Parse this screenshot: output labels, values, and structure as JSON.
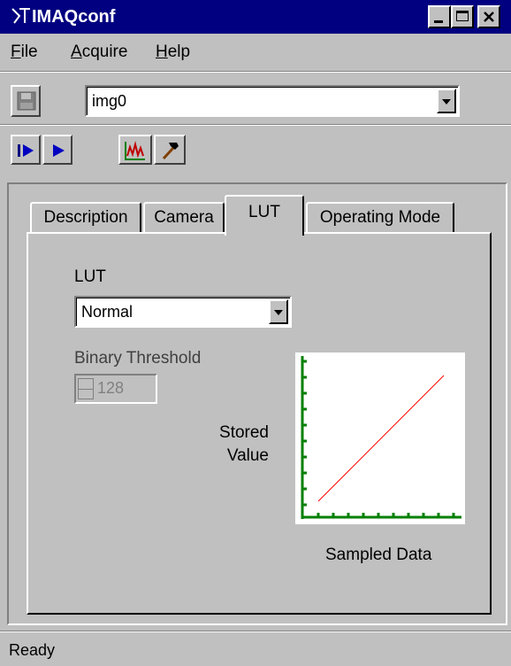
{
  "window": {
    "title": "IMAQconf"
  },
  "menu": [
    {
      "label": "File"
    },
    {
      "label": "Acquire"
    },
    {
      "label": "Help"
    }
  ],
  "toolbar": {
    "interface_select": {
      "value": "img0"
    }
  },
  "tabs": [
    {
      "label": "Description",
      "selected": false
    },
    {
      "label": "Camera",
      "selected": false
    },
    {
      "label": "LUT",
      "selected": true
    },
    {
      "label": "Operating Mode",
      "selected": false
    }
  ],
  "lut_panel": {
    "lut_label": "LUT",
    "lut_value": "Normal",
    "threshold_label": "Binary Threshold",
    "threshold_value": "128",
    "y_label_line1": "Stored",
    "y_label_line2": "Value",
    "x_label": "Sampled Data"
  },
  "status": {
    "text": "Ready"
  },
  "colors": {
    "titlebar": "#000080",
    "lut_line": "#ff0000",
    "axes": "#008000"
  }
}
